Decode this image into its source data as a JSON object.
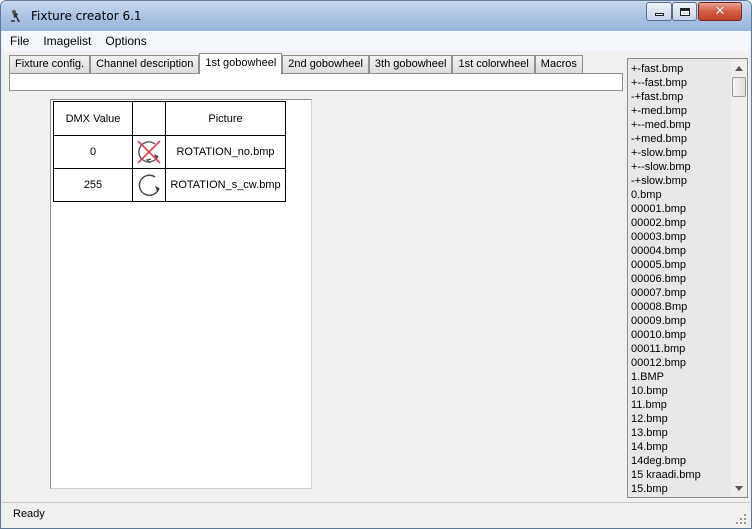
{
  "window": {
    "title": "Fixture creator 6.1",
    "icon": "fixture-app-icon",
    "controls": {
      "minimize": "minimize-icon",
      "maximize": "maximize-icon",
      "close": "✕"
    }
  },
  "menu": {
    "items": [
      {
        "label": "File"
      },
      {
        "label": "Imagelist"
      },
      {
        "label": "Options"
      }
    ]
  },
  "tabs": {
    "active_index": 2,
    "items": [
      {
        "label": "Fixture config."
      },
      {
        "label": "Channel description"
      },
      {
        "label": "1st gobowheel"
      },
      {
        "label": "2nd gobowheel"
      },
      {
        "label": "3th gobowheel"
      },
      {
        "label": "1st colorwheel"
      },
      {
        "label": "Macros"
      }
    ]
  },
  "gobo_table": {
    "headers": {
      "dmx": "DMX Value",
      "image": "",
      "picture": "Picture"
    },
    "rows": [
      {
        "dmx": "0",
        "icon": "rotation-no-icon",
        "picture": "ROTATION_no.bmp"
      },
      {
        "dmx": "255",
        "icon": "rotation-clockwise-icon",
        "picture": "ROTATION_s_cw.bmp"
      }
    ]
  },
  "image_list": {
    "items": [
      "+-fast.bmp",
      "+--fast.bmp",
      "-+fast.bmp",
      "+-med.bmp",
      "+--med.bmp",
      "-+med.bmp",
      "+-slow.bmp",
      "+--slow.bmp",
      "-+slow.bmp",
      "0.bmp",
      "00001.bmp",
      "00002.bmp",
      "00003.bmp",
      "00004.bmp",
      "00005.bmp",
      "00006.bmp",
      "00007.bmp",
      "00008.Bmp",
      "00009.bmp",
      "00010.bmp",
      "00011.bmp",
      "00012.bmp",
      "1.BMP",
      "10.bmp",
      "11.bmp",
      "12.bmp",
      "13.bmp",
      "14.bmp",
      "14deg.bmp",
      "15 kraadi.bmp",
      "15.bmp"
    ]
  },
  "status": {
    "text": "Ready"
  },
  "colors": {
    "titlebar": "#a9c2e4",
    "close_button": "#c2402a",
    "window_background": "#f0f0f0",
    "list_background": "#e8e8e8",
    "no_rotation_cross": "#e04040"
  }
}
